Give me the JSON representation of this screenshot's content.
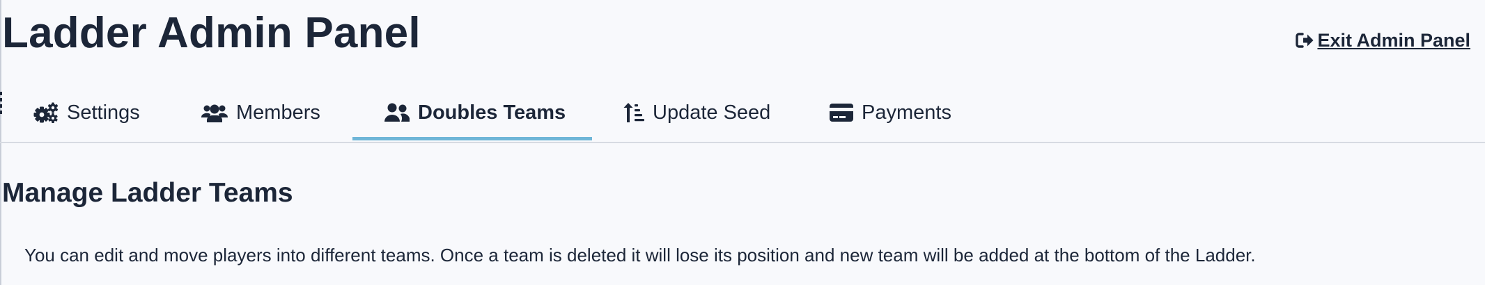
{
  "header": {
    "title": "Ladder Admin Panel",
    "exit_label": "Exit Admin Panel",
    "exit_icon": "sign-out-icon"
  },
  "tabs": [
    {
      "label": "Settings",
      "icon": "gears-icon",
      "active": false
    },
    {
      "label": "Members",
      "icon": "users-icon",
      "active": false
    },
    {
      "label": "Doubles Teams",
      "icon": "user-group-icon",
      "active": true
    },
    {
      "label": "Update Seed",
      "icon": "sort-amount-up-icon",
      "active": false
    },
    {
      "label": "Payments",
      "icon": "credit-card-icon",
      "active": false
    }
  ],
  "main": {
    "section_title": "Manage Ladder Teams",
    "description": "You can edit and move players into different teams. Once a team is deleted it will lose its position and new team will be added at the bottom of the Ladder."
  },
  "colors": {
    "text": "#1c2638",
    "background": "#f8f9fc",
    "active_tab_underline": "#6fb6d8",
    "divider": "#d7dbe2"
  }
}
